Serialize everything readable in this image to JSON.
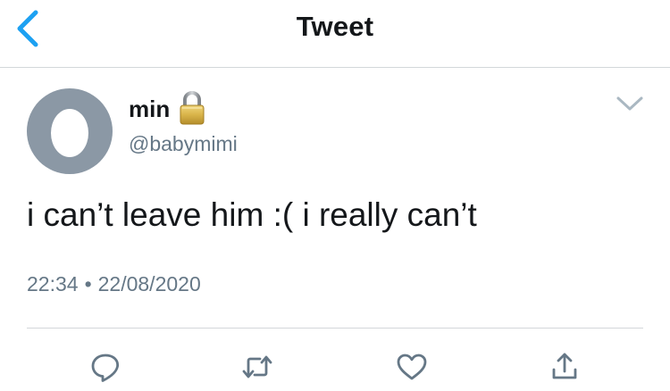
{
  "header": {
    "title": "Tweet",
    "back_icon": "chevron-left-icon",
    "accent_color": "#1da1f2"
  },
  "tweet": {
    "author": {
      "name": "min",
      "handle": "@babymimi",
      "protected_icon": "lock-icon",
      "avatar": "default-egg-avatar"
    },
    "text": "i can’t leave him :( i really can’t",
    "time": "22:34",
    "separator": "•",
    "date": "22/08/2020",
    "menu_icon": "chevron-down-icon"
  },
  "actions": [
    {
      "name": "reply",
      "icon": "reply-icon"
    },
    {
      "name": "retweet",
      "icon": "retweet-icon"
    },
    {
      "name": "like",
      "icon": "heart-icon"
    },
    {
      "name": "share",
      "icon": "share-icon"
    }
  ],
  "colors": {
    "text_primary": "#14171a",
    "text_secondary": "#657786",
    "divider": "#d3d7da",
    "avatar_bg": "#8b98a5"
  }
}
